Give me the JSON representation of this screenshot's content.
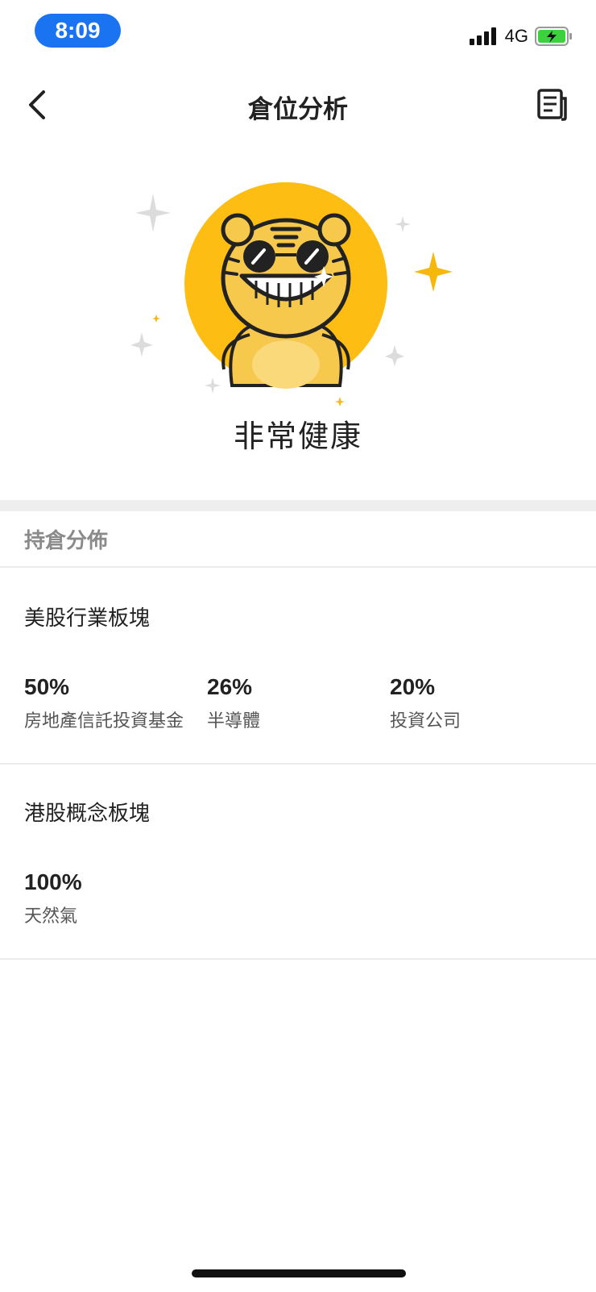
{
  "status_bar": {
    "time": "8:09",
    "network": "4G"
  },
  "nav": {
    "title": "倉位分析"
  },
  "hero": {
    "status_text": "非常健康",
    "colors": {
      "accent": "#f5b80b",
      "battery": "#3dd13d"
    }
  },
  "section_header": "持倉分佈",
  "us_block": {
    "title": "美股行業板塊",
    "items": [
      {
        "value": "50%",
        "label": "房地產信託投資基金"
      },
      {
        "value": "26%",
        "label": "半導體"
      },
      {
        "value": "20%",
        "label": "投資公司"
      }
    ]
  },
  "hk_block": {
    "title": "港股概念板塊",
    "items": [
      {
        "value": "100%",
        "label": "天然氣"
      }
    ]
  }
}
